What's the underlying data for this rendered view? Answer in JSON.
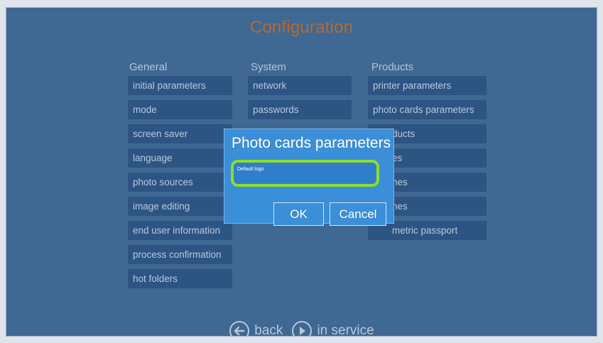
{
  "title": "Configuration",
  "columns": {
    "general": {
      "heading": "General",
      "items": [
        "initial parameters",
        "mode",
        "screen saver",
        "language",
        "photo sources",
        "image editing",
        "end user information",
        "process confirmation",
        "hot folders"
      ]
    },
    "system": {
      "heading": "System",
      "items": [
        "network",
        "passwords"
      ]
    },
    "products": {
      "heading": "Products",
      "items": [
        "printer parameters",
        "photo cards parameters",
        "ducts",
        "es",
        "nes",
        "nes",
        "metric passport"
      ]
    }
  },
  "dialog": {
    "title": "Photo cards parameters",
    "field_label": "Default logo",
    "ok_label": "OK",
    "cancel_label": "Cancel"
  },
  "nav": {
    "back_label": "back",
    "in_service_label": "in service",
    "back_icon": "arrow-left-circle-icon",
    "in_service_icon": "play-circle-icon"
  },
  "colors": {
    "background": "#3f6892",
    "button": "#2d5583",
    "title": "#b86a2b",
    "dialog": "#3b8ed8",
    "highlight": "#8bde2a"
  }
}
